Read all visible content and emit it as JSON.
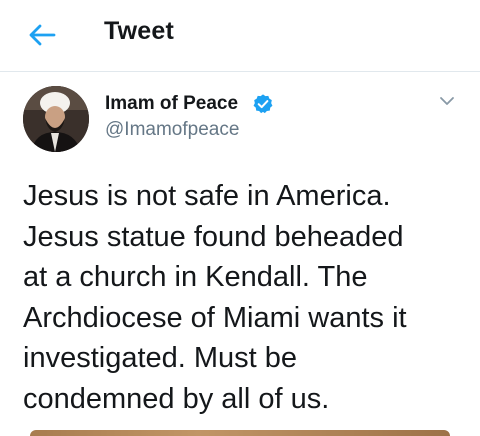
{
  "header": {
    "title": "Tweet",
    "back_icon": "arrow-left-icon"
  },
  "tweet": {
    "author_name": "Imam of Peace",
    "handle": "@Imamofpeace",
    "verified": true,
    "verified_icon": "verified-badge-icon",
    "more_icon": "chevron-down-icon",
    "text": "Jesus is not safe in America.\nJesus statue found beheaded\nat a church in Kendall. The\nArchdiocese of Miami wants it\ninvestigated. Must be\ncondemned by all of us."
  },
  "colors": {
    "accent": "#1da1f2",
    "text": "#14171a",
    "secondary_text": "#657786",
    "divider": "#e1e8ed"
  }
}
